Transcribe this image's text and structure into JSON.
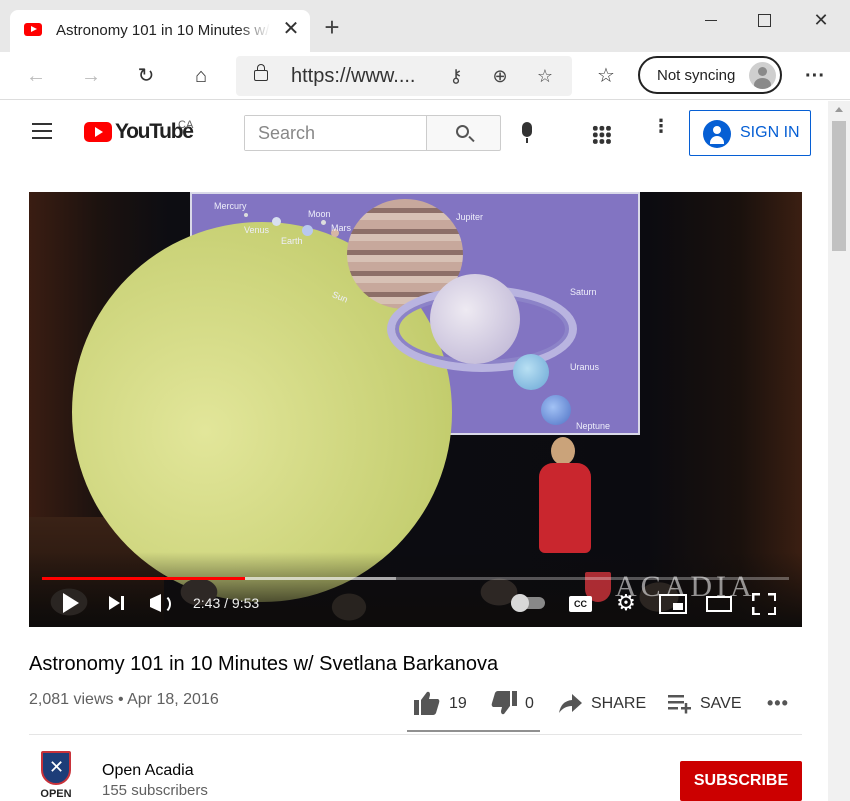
{
  "browser": {
    "tab_title": "Astronomy 101 in 10 Minutes w/ Svetlana Barkanova",
    "tab_close": "✕",
    "new_tab": "+",
    "window_close": "✕",
    "url": "https://www....",
    "sync_label": "Not syncing",
    "icons": {
      "back": "←",
      "forward": "→",
      "refresh": "↻",
      "home": "⌂",
      "key": "⚷",
      "add": "⊕",
      "add_favorite": "☆",
      "favorites": "☆",
      "menu": "···"
    }
  },
  "youtube": {
    "logo_wordmark": "YouTube",
    "country": "CA",
    "search_placeholder": "Search",
    "more_symbol": "⋮",
    "sign_in": "SIGN IN"
  },
  "player": {
    "time_display": "2:43 / 9:53",
    "played_fraction": 0.272,
    "buffered_fraction": 0.474,
    "cc_label": "CC",
    "settings_symbol": "⚙",
    "slide_labels": {
      "mercury": "Mercury",
      "venus": "Venus",
      "earth": "Earth",
      "moon": "Moon",
      "mars": "Mars",
      "jupiter": "Jupiter",
      "sun": "Sun",
      "saturn": "Saturn",
      "uranus": "Uranus",
      "neptune": "Neptune"
    },
    "watermark": "ACADIA"
  },
  "video": {
    "title": "Astronomy 101 in 10 Minutes w/ Svetlana Barkanova",
    "views_date": "2,081 views • Apr 18, 2016",
    "likes": "19",
    "dislikes": "0",
    "share_label": "SHARE",
    "save_label": "SAVE",
    "more_symbol": "•••"
  },
  "channel": {
    "name": "Open Acadia",
    "subscribers": "155 subscribers",
    "logo_text": "OPEN",
    "subscribe_label": "SUBSCRIBE"
  },
  "colors": {
    "youtube_red": "#ff0000",
    "subscribe_red": "#cc0000",
    "signin_blue": "#065fd4",
    "progress_red": "#ff0000"
  }
}
